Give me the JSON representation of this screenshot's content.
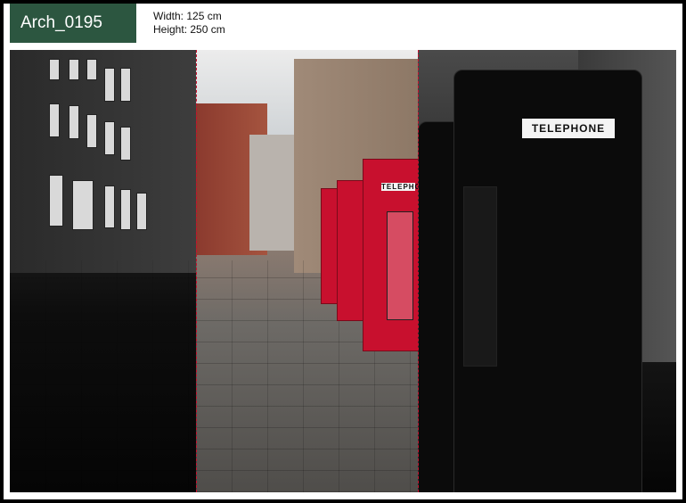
{
  "product": {
    "code": "Arch_0195",
    "width_text": "Width: 125 cm",
    "height_text": "Height: 250 cm"
  },
  "colors": {
    "badge_bg": "#2c5640",
    "accent_red": "#c8102e",
    "frame": "#000000"
  },
  "photo": {
    "booth_sign": "TELEPHONE"
  }
}
